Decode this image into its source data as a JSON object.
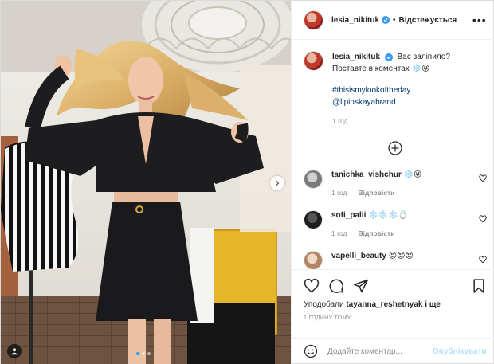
{
  "post": {
    "author": "lesia_nikituk",
    "follow_separator": "•",
    "follow_state": "Відстежується",
    "more": "•••"
  },
  "caption": {
    "line1": "Вас заліпило?",
    "line2": "Поставте в коментах ❄️😜",
    "hashtag": "#thisismylookoftheday",
    "mention": "@lipinskayabrand",
    "time": "1 год"
  },
  "comments": [
    {
      "username": "tanichka_vishchur",
      "text": "❄️😜",
      "time": "1 год",
      "reply": "Відповісти"
    },
    {
      "username": "sofi_palii",
      "text": "❄️❄️❄️💍",
      "time": "1 год",
      "reply": "Відповісти"
    },
    {
      "username": "vapelli_beauty",
      "text": "😍😍😍",
      "time": "",
      "reply": ""
    }
  ],
  "likes": {
    "prefix": "Уподобали",
    "liker": "tayanna_reshetnyak",
    "suffix": "і ще"
  },
  "post_time": "1 ГОДИНУ ТОМУ",
  "add_comment": {
    "placeholder": "Додайте коментар...",
    "publish": "Опублікувати"
  },
  "carousel": {
    "total": 3,
    "active": 1
  },
  "colors": {
    "link": "#00376b",
    "verified": "#3897f0",
    "muted": "#8e8e8e",
    "publish_disabled": "#b2dffc",
    "carousel_active": "#1da1f2"
  },
  "icons": [
    "heart-icon",
    "comment-icon",
    "share-icon",
    "bookmark-icon",
    "emoji-icon",
    "plus-circle-icon",
    "chevron-right-icon",
    "user-tag-icon",
    "verified-icon"
  ]
}
